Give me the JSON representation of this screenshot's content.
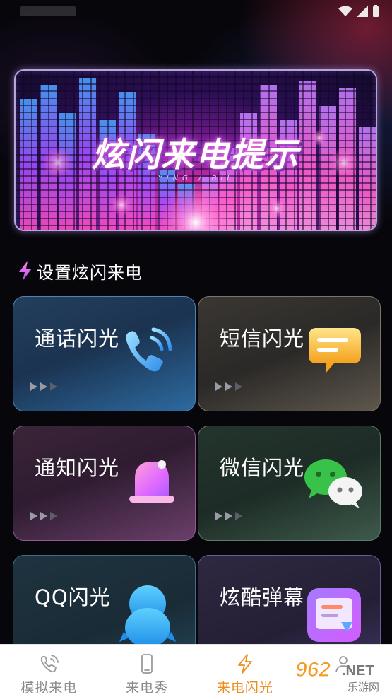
{
  "banner": {
    "title": "炫闪来电提示",
    "subtitle": "YING / BII"
  },
  "section": {
    "title": "设置炫闪来电",
    "icon": "lightning-icon"
  },
  "cards": [
    {
      "label": "通话闪光",
      "icon": "phone-call-icon"
    },
    {
      "label": "短信闪光",
      "icon": "sms-bubble-icon"
    },
    {
      "label": "通知闪光",
      "icon": "bell-icon"
    },
    {
      "label": "微信闪光",
      "icon": "wechat-icon"
    },
    {
      "label": "QQ闪光",
      "icon": "qq-penguin-icon"
    },
    {
      "label": "炫酷弹幕",
      "icon": "danmaku-icon"
    }
  ],
  "nav": [
    {
      "label": "模拟来电",
      "icon": "phone-wave-icon",
      "active": false
    },
    {
      "label": "来电秀",
      "icon": "mobile-phone-icon",
      "active": false
    },
    {
      "label": "来电闪光",
      "icon": "lightning-icon",
      "active": true
    },
    {
      "label": "",
      "icon": "profile-icon",
      "active": false
    }
  ],
  "colors": {
    "accent": "#f08c1e",
    "nav_inactive": "#8b8b8b",
    "background": "#07060b"
  },
  "watermark": {
    "brand": "962",
    "suffix": ".NET",
    "caption": "乐游网"
  }
}
